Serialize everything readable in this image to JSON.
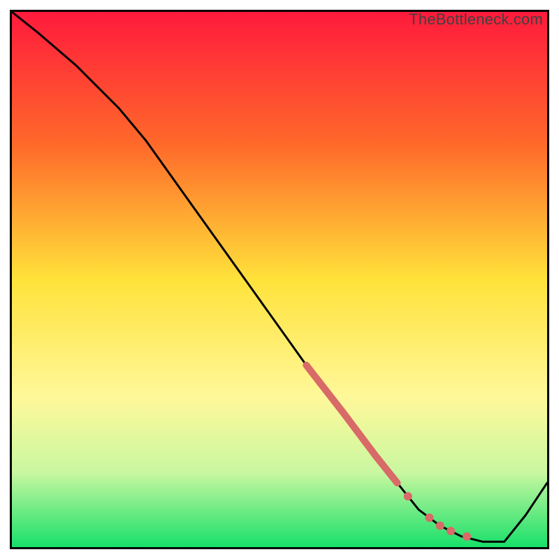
{
  "watermark": "TheBottleneck.com",
  "chart_data": {
    "type": "line",
    "title": "",
    "xlabel": "",
    "ylabel": "",
    "xlim": [
      0,
      100
    ],
    "ylim": [
      0,
      100
    ],
    "grid": false,
    "legend": false,
    "gradient_stops": [
      {
        "pct": 0,
        "color": "#ff1a3c"
      },
      {
        "pct": 25,
        "color": "#ff6a2a"
      },
      {
        "pct": 50,
        "color": "#ffe23a"
      },
      {
        "pct": 72,
        "color": "#fff89a"
      },
      {
        "pct": 86,
        "color": "#c9f7a0"
      },
      {
        "pct": 100,
        "color": "#17e06a"
      }
    ],
    "series": [
      {
        "name": "curve",
        "type": "line",
        "color": "#000000",
        "x": [
          0,
          5,
          12,
          20,
          25,
          35,
          45,
          55,
          62,
          68,
          72,
          76,
          80,
          84,
          88,
          92,
          96,
          100
        ],
        "y": [
          100,
          96,
          90,
          82,
          76,
          62,
          48,
          34,
          25,
          17,
          12,
          7,
          4,
          2,
          1,
          1,
          6,
          12
        ]
      },
      {
        "name": "highlight-thick",
        "type": "line",
        "color": "#d86a68",
        "width": 10,
        "x": [
          55,
          62,
          68,
          72
        ],
        "y": [
          34,
          25,
          17,
          12
        ]
      },
      {
        "name": "markers",
        "type": "scatter",
        "color": "#d86a68",
        "x": [
          74,
          78,
          80,
          82,
          85
        ],
        "y": [
          9.5,
          5.5,
          4,
          3,
          2
        ]
      }
    ]
  }
}
